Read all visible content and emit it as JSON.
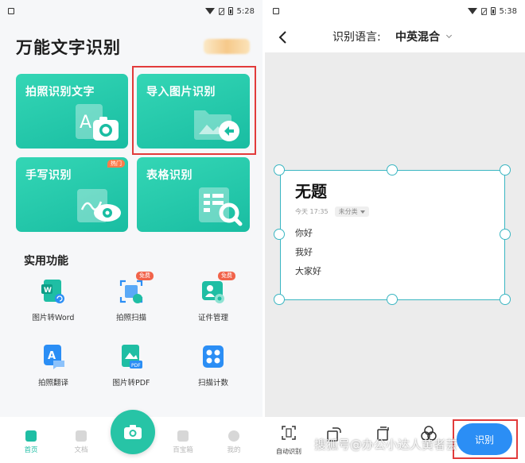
{
  "left": {
    "status": {
      "time": "5:28"
    },
    "app_title": "万能文字识别",
    "cards": {
      "photo": "拍照识别文字",
      "import": "导入图片识别",
      "hand": "手写识别",
      "hand_badge": "热门",
      "table": "表格识别"
    },
    "section_title": "实用功能",
    "features": [
      {
        "label": "图片转Word",
        "icon": "word-icon",
        "badge": ""
      },
      {
        "label": "拍照扫描",
        "icon": "scan-icon",
        "badge": "免费"
      },
      {
        "label": "证件管理",
        "icon": "id-card-icon",
        "badge": "免费"
      },
      {
        "label": "拍照翻译",
        "icon": "translate-icon",
        "badge": ""
      },
      {
        "label": "图片转PDF",
        "icon": "pdf-icon",
        "badge": ""
      },
      {
        "label": "扫描计数",
        "icon": "count-icon",
        "badge": ""
      }
    ],
    "nav": [
      {
        "label": "首页",
        "active": true
      },
      {
        "label": "文档",
        "active": false
      },
      {
        "label": "百宝箱",
        "active": false
      },
      {
        "label": "我的",
        "active": false
      }
    ]
  },
  "right": {
    "status": {
      "time": "5:38"
    },
    "lang_label": "识别语言:",
    "lang_value": "中英混合",
    "doc": {
      "title": "无题",
      "date": "今天 17:35",
      "category": "未分类",
      "lines": [
        "你好",
        "我好",
        "大家好"
      ]
    },
    "tools": [
      {
        "label": "自动识别"
      }
    ],
    "recognize_label": "识别"
  },
  "watermark": "搜狐号@办公小达人黄者芸",
  "colors": {
    "accent_green": "#1fbea4",
    "accent_blue": "#2b8ef5",
    "highlight_red": "#e23b3b",
    "frame_teal": "#3ab6c2"
  }
}
